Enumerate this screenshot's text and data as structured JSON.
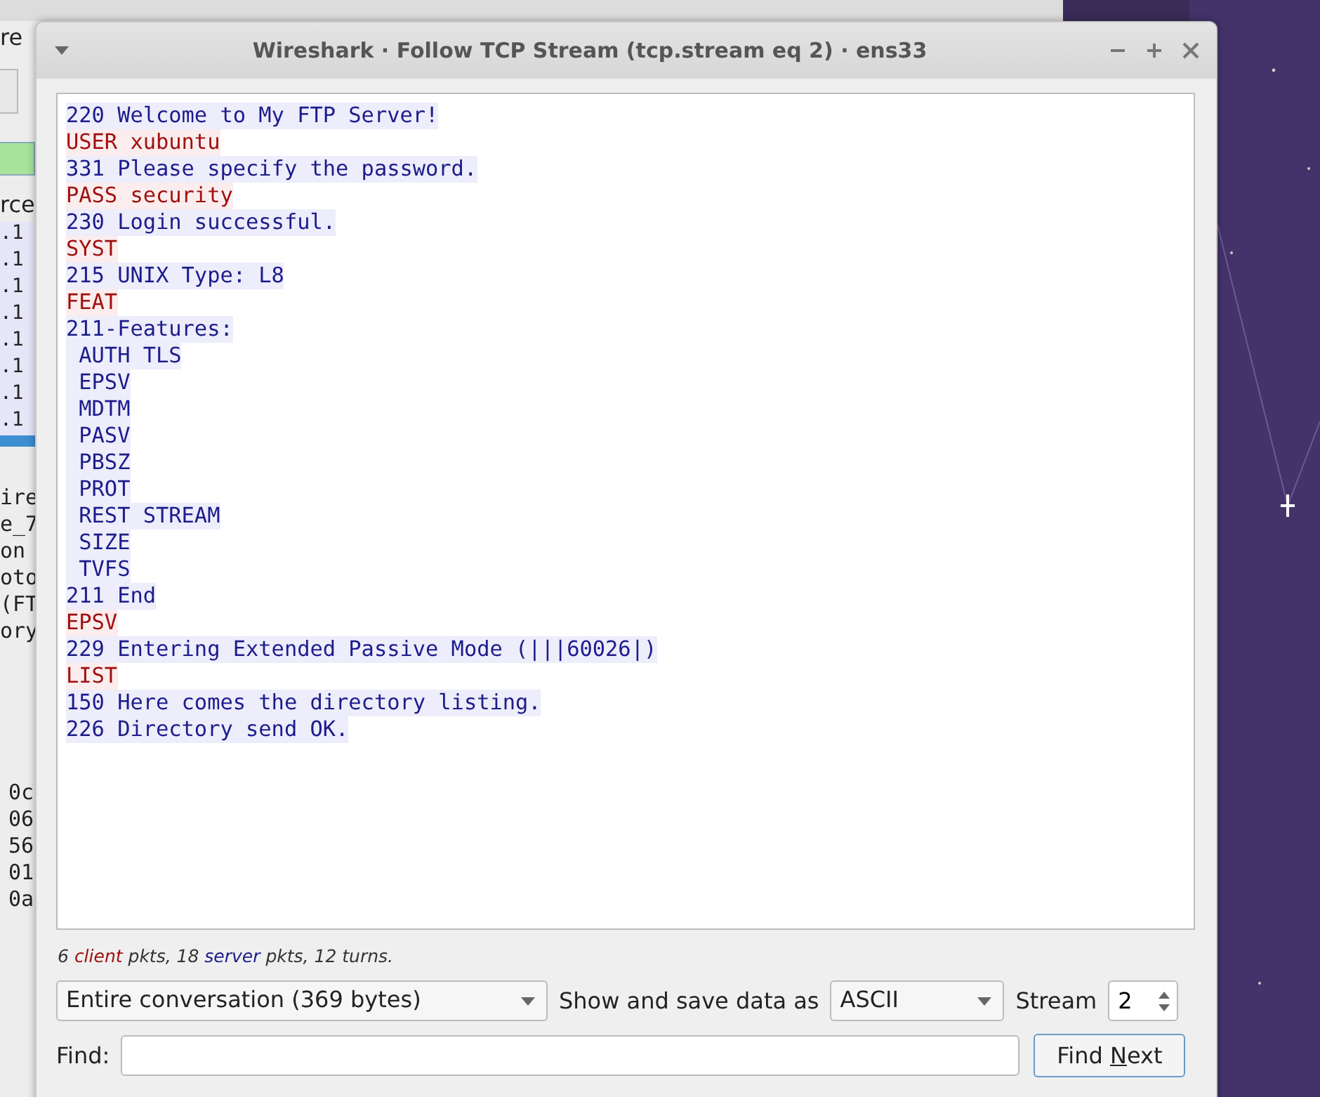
{
  "background_window": {
    "menu_fragment": "re",
    "column_fragment": "rce",
    "rows": [
      {
        "text": ".1",
        "selected": false
      },
      {
        "text": ".1",
        "selected": false
      },
      {
        "text": ".1",
        "selected": false
      },
      {
        "text": ".1",
        "selected": false
      },
      {
        "text": ".1",
        "selected": false
      },
      {
        "text": ".1",
        "selected": false
      },
      {
        "text": ".1",
        "selected": false
      },
      {
        "text": ".1",
        "selected": false
      },
      {
        "selected": true
      }
    ],
    "detail_lines": [
      "ire",
      "e_7",
      "on",
      "oto",
      "(FT",
      "ory"
    ],
    "hex_lines": [
      "0c",
      "06",
      "56",
      "01",
      "0a"
    ]
  },
  "dialog": {
    "title": "Wireshark · Follow TCP Stream (tcp.stream eq 2) · ens33",
    "stream": [
      {
        "kind": "server",
        "text": "220 Welcome to My FTP Server!"
      },
      {
        "kind": "client",
        "text": "USER xubuntu"
      },
      {
        "kind": "server",
        "text": "331 Please specify the password."
      },
      {
        "kind": "client",
        "text": "PASS security"
      },
      {
        "kind": "server",
        "text": "230 Login successful."
      },
      {
        "kind": "client",
        "text": "SYST"
      },
      {
        "kind": "server",
        "text": "215 UNIX Type: L8"
      },
      {
        "kind": "client",
        "text": "FEAT"
      },
      {
        "kind": "server",
        "text": "211-Features:"
      },
      {
        "kind": "server",
        "text": " AUTH TLS"
      },
      {
        "kind": "server",
        "text": " EPSV"
      },
      {
        "kind": "server",
        "text": " MDTM"
      },
      {
        "kind": "server",
        "text": " PASV"
      },
      {
        "kind": "server",
        "text": " PBSZ"
      },
      {
        "kind": "server",
        "text": " PROT"
      },
      {
        "kind": "server",
        "text": " REST STREAM"
      },
      {
        "kind": "server",
        "text": " SIZE"
      },
      {
        "kind": "server",
        "text": " TVFS"
      },
      {
        "kind": "server",
        "text": "211 End"
      },
      {
        "kind": "client",
        "text": "EPSV"
      },
      {
        "kind": "server",
        "text": "229 Entering Extended Passive Mode (|||60026|)"
      },
      {
        "kind": "client",
        "text": "LIST"
      },
      {
        "kind": "server",
        "text": "150 Here comes the directory listing."
      },
      {
        "kind": "server",
        "text": "226 Directory send OK."
      }
    ],
    "summary": [
      {
        "kind": "plain",
        "text": "6 "
      },
      {
        "kind": "client",
        "text": "client"
      },
      {
        "kind": "plain",
        "text": " pkts, 18 "
      },
      {
        "kind": "server",
        "text": "server"
      },
      {
        "kind": "plain",
        "text": " pkts, 12 turns."
      }
    ],
    "conversation_select": "Entire conversation (369 bytes)",
    "show_label": "Show and save data as",
    "format_select": "ASCII",
    "stream_label": "Stream",
    "stream_value": "2",
    "find_label": "Find:",
    "find_button": {
      "before": "Find ",
      "mnemonic": "N",
      "after": "ext"
    }
  }
}
